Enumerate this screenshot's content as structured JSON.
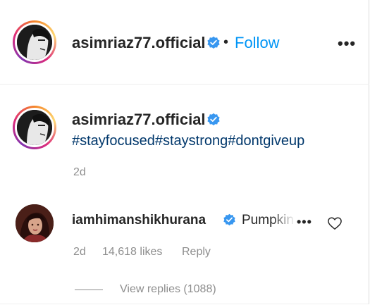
{
  "post_header": {
    "username": "asimriaz77.official",
    "separator": "•",
    "follow_label": "Follow",
    "more_label": "•••"
  },
  "caption": {
    "username": "asimriaz77.official",
    "text": "#stayfocused#staystrong#dontgiveup",
    "time": "2d"
  },
  "comment": {
    "username": "iamhimanshikhurana",
    "text": "Pumpkin",
    "more_label": "•••",
    "time": "2d",
    "likes": "14,618 likes",
    "reply_label": "Reply",
    "view_replies": "View replies (1088)"
  },
  "colors": {
    "link": "#0095f6",
    "hashtag": "#00376b",
    "muted": "#8e8e8e",
    "verified": "#3897f0"
  },
  "icons": {
    "verified": "verified-badge-icon",
    "heart": "heart-outline-icon",
    "more": "more-dots-icon"
  }
}
